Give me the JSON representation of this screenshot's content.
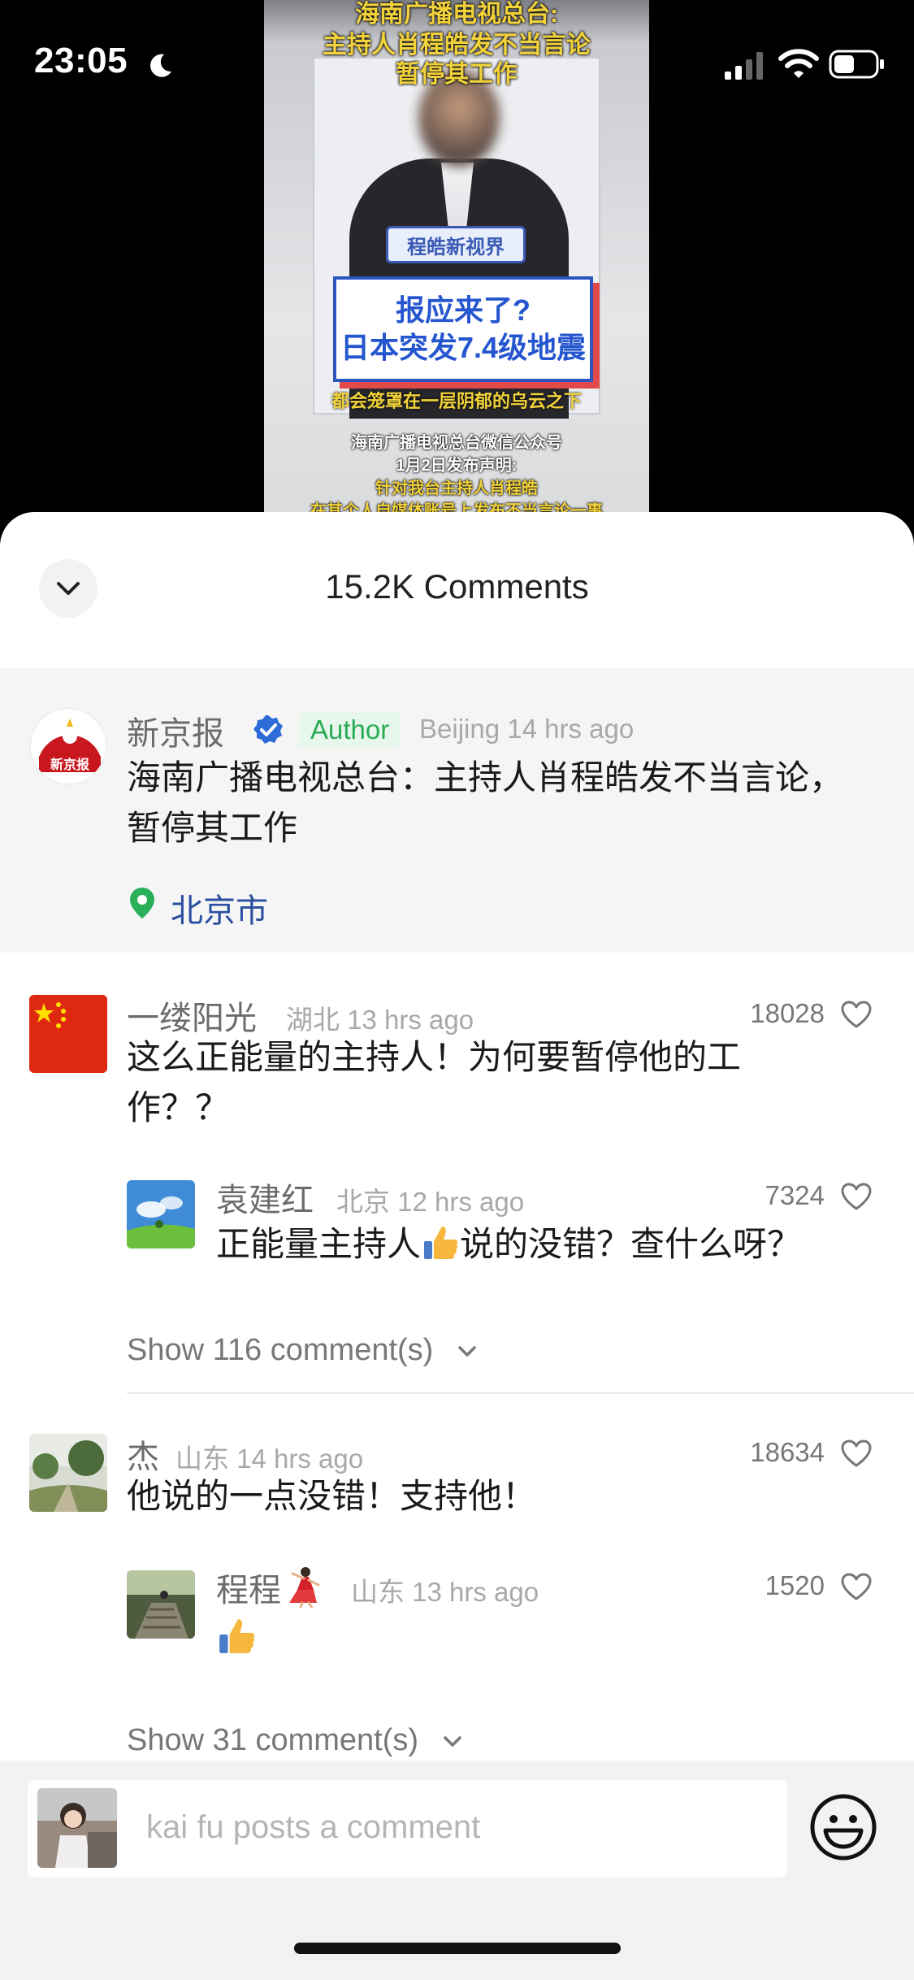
{
  "status_bar": {
    "time": "23:05"
  },
  "video": {
    "title_line1": "海南广播电视总台:",
    "title_line2": "主持人肖程皓发不当言论",
    "title_line3": "暂停其工作",
    "channel": "程皓新视界",
    "headline_line1": "报应来了?",
    "headline_line2": "日本突发7.4级地震",
    "caption": "都会笼罩在一层阴郁的乌云之下",
    "text_line1": "海南广播电视总台微信公众号",
    "text_line2": "1月2日发布声明:",
    "text_line3": "针对我台主持人肖程皓",
    "text_line4": "在其个人自媒体账号上发布不当言论一事"
  },
  "sheet": {
    "title": "15.2K Comments"
  },
  "pinned": {
    "name": "新京报",
    "author_tag": "Author",
    "meta": "Beijing 14 hrs ago",
    "text": "海南广播电视总台：主持人肖程皓发不当言论，暂停其工作",
    "location": "北京市",
    "avatar_text": "新京报"
  },
  "comments": [
    {
      "name": "一缕阳光",
      "meta": "湖北 13 hrs ago",
      "likes": "18028",
      "text": "这么正能量的主持人！为何要暂停他的工作？？",
      "reply": {
        "name": "袁建红",
        "meta": "北京 12 hrs ago",
        "likes": "7324",
        "text_before": "正能量主持人",
        "text_after": "说的没错？查什么呀？"
      },
      "show_more": "Show 116 comment(s)"
    },
    {
      "name": "杰",
      "meta": "山东 14 hrs ago",
      "likes": "18634",
      "text": "他说的一点没错！支持他！",
      "reply": {
        "name": "程程",
        "meta": "山东 13 hrs ago",
        "likes": "1520",
        "text": ""
      },
      "show_more": "Show 31 comment(s)"
    }
  ],
  "input": {
    "placeholder": "kai fu posts a comment"
  },
  "colors": {
    "author_tag_bg": "#e7f7ec",
    "author_tag_text": "#2bab55",
    "location": "#2a4fa0",
    "verified": "#2d6bd6"
  }
}
